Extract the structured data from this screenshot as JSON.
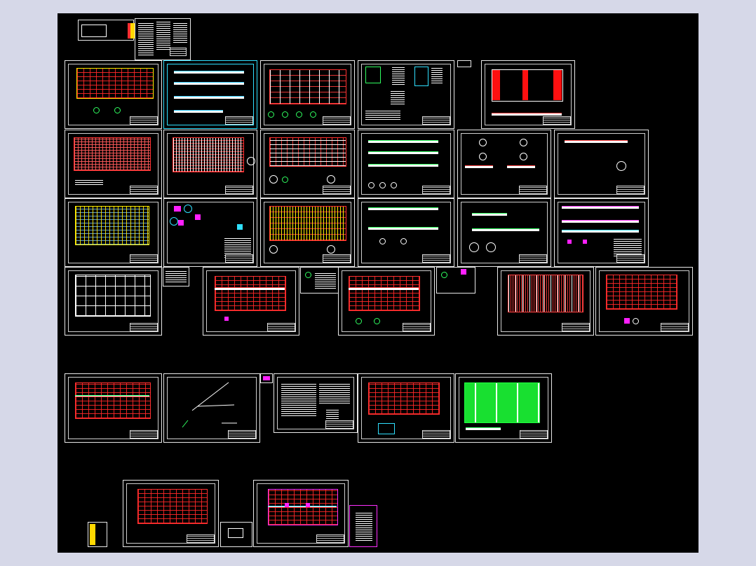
{
  "viewer": {
    "background": "#d6d8e8",
    "canvas_color": "#000000"
  },
  "cover": {
    "title_box_text": "",
    "legend_label": ""
  },
  "colors": {
    "grid_red": "#ff3030",
    "grid_yellow": "#ffee00",
    "grid_green": "#18e030",
    "magenta": "#ff20ff",
    "cyan": "#30e0ff",
    "border": "#e8e8e8"
  },
  "sheets": {
    "row1": [
      "plan-red-grid",
      "elevations-cyan",
      "plan-frame",
      "details",
      "plan-red-fill"
    ],
    "row2": [
      "plan-red-grid",
      "plan-red-dense",
      "plan-red-beams",
      "elevations",
      "details-small",
      "detail-single"
    ],
    "row3": [
      "plan-yellow-grid",
      "details-magenta",
      "plan-yellow-red",
      "elevations",
      "elevations-small",
      "elevations-magenta"
    ],
    "row4": [
      "plan-grid",
      "truss-plan",
      "truss-plan",
      "plan-vertical",
      "plan-red-grid"
    ],
    "row5": [
      "plan-red-grid",
      "isometric",
      "notes",
      "plan-red-grid",
      "plan-green"
    ],
    "row6": [
      "plan-red-grid",
      "plan-red-magenta"
    ]
  }
}
